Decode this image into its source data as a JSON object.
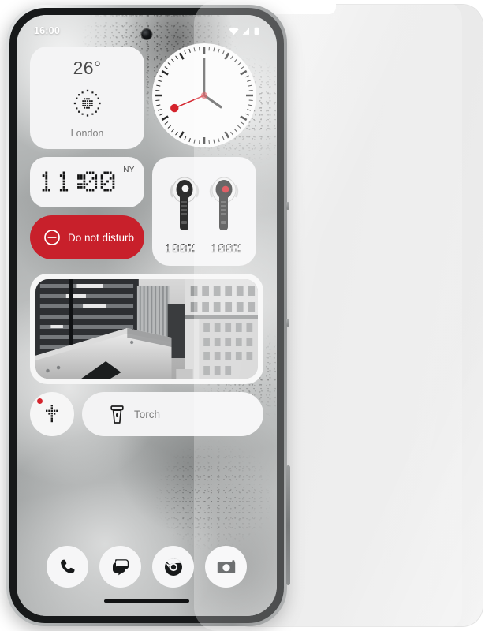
{
  "device": {
    "name": "smartphone",
    "frame_color": "#8e9192",
    "accessory": "screen-protector-sheet"
  },
  "statusbar": {
    "time": "16:00",
    "icons": [
      "wifi-icon",
      "signal-icon",
      "battery-icon"
    ]
  },
  "widgets": {
    "weather": {
      "name": "weather-widget",
      "temperature": "26°",
      "city": "London",
      "icon": "dot-matrix-sun-icon"
    },
    "analog_clock": {
      "name": "analog-clock-widget",
      "hour_angle": 125,
      "minute_angle": 0,
      "second_angle": 247,
      "second_hand_color": "#d4232c"
    },
    "digital_clock": {
      "name": "world-clock-widget",
      "time": "11:00",
      "zone": "NY"
    },
    "earbuds": {
      "name": "earbuds-widget",
      "left_battery": "100%",
      "right_battery": "100%",
      "left_accent": "#f2f2f2",
      "right_accent": "#d4232c"
    },
    "do_not_disturb": {
      "name": "do-not-disturb-toggle",
      "label": "Do not disturb",
      "icon": "minus-circle-icon",
      "color": "#c8202b",
      "state": "on"
    },
    "photo": {
      "name": "photo-widget",
      "description": "black and white city architecture"
    },
    "round_shortcut": {
      "name": "glyph-shortcut-widget",
      "icon": "dot-matrix-cross-icon",
      "badge_color": "#d4232c",
      "has_badge": true
    },
    "torch": {
      "name": "torch-toggle",
      "label": "Torch",
      "icon": "flashlight-icon",
      "state": "off"
    }
  },
  "dock": {
    "items": [
      {
        "name": "dock-phone",
        "icon": "phone-icon"
      },
      {
        "name": "dock-messages",
        "icon": "message-bubble-icon"
      },
      {
        "name": "dock-chrome",
        "icon": "chrome-icon"
      },
      {
        "name": "dock-camera",
        "icon": "camera-icon"
      }
    ]
  },
  "navigation": {
    "home_indicator": "gesture-bar"
  }
}
